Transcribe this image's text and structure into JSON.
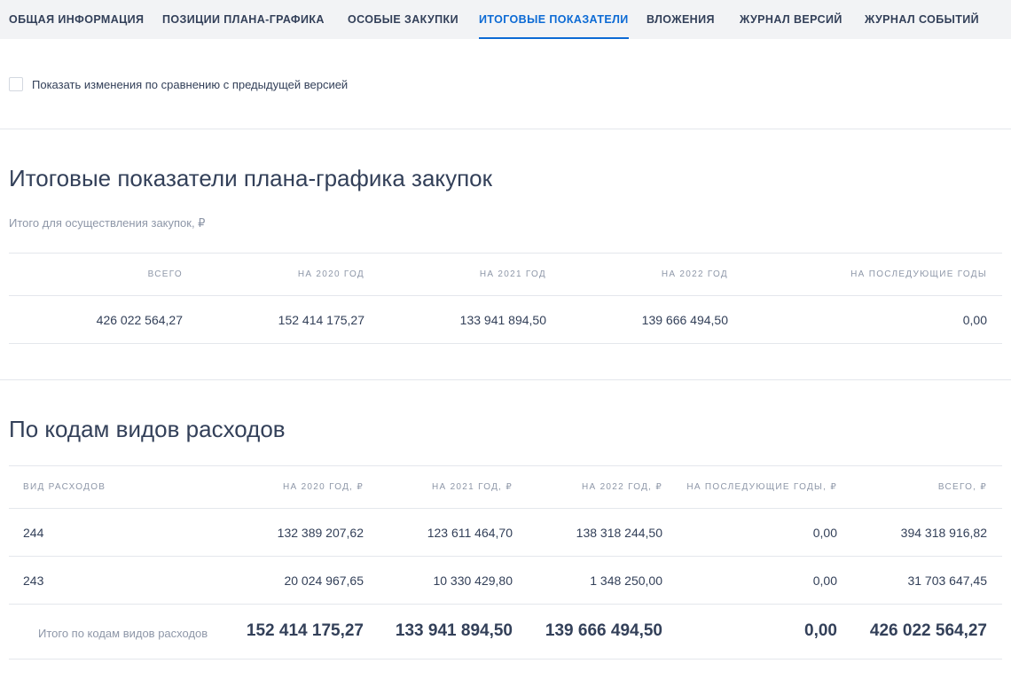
{
  "tabs": [
    {
      "label": "ОБЩАЯ ИНФОРМАЦИЯ",
      "active": false
    },
    {
      "label": "ПОЗИЦИИ ПЛАНА-ГРАФИКА",
      "active": false
    },
    {
      "label": "ОСОБЫЕ ЗАКУПКИ",
      "active": false
    },
    {
      "label": "ИТОГОВЫЕ ПОКАЗАТЕЛИ",
      "active": true
    },
    {
      "label": "ВЛОЖЕНИЯ",
      "active": false
    },
    {
      "label": "ЖУРНАЛ ВЕРСИЙ",
      "active": false
    },
    {
      "label": "ЖУРНАЛ СОБЫТИЙ",
      "active": false
    }
  ],
  "compare": {
    "label": "Показать изменения по сравнению с предыдущей версией",
    "checked": false
  },
  "summary": {
    "title": "Итоговые показатели плана-графика закупок",
    "subtitle": "Итого для осуществления закупок, ₽",
    "columns": [
      "ВСЕГО",
      "НА 2020 ГОД",
      "НА 2021 ГОД",
      "НА 2022 ГОД",
      "НА ПОСЛЕДУЮЩИЕ ГОДЫ"
    ],
    "values": [
      "426 022 564,27",
      "152 414 175,27",
      "133 941 894,50",
      "139 666 494,50",
      "0,00"
    ]
  },
  "by_codes": {
    "title": "По кодам видов расходов",
    "columns": [
      "ВИД РАСХОДОВ",
      "НА 2020 ГОД, ₽",
      "НА 2021 ГОД, ₽",
      "НА 2022 ГОД, ₽",
      "НА ПОСЛЕДУЮЩИЕ ГОДЫ, ₽",
      "ВСЕГО, ₽"
    ],
    "rows": [
      [
        "244",
        "132 389 207,62",
        "123 611 464,70",
        "138 318 244,50",
        "0,00",
        "394 318 916,82"
      ],
      [
        "243",
        "20 024 967,65",
        "10 330 429,80",
        "1 348 250,00",
        "0,00",
        "31 703 647,45"
      ]
    ],
    "total_label": "Итого по кодам видов расходов",
    "totals": [
      "152 414 175,27",
      "133 941 894,50",
      "139 666 494,50",
      "0,00",
      "426 022 564,27"
    ]
  },
  "colors": {
    "accent": "#0c6ad4",
    "text": "#334059",
    "muted": "#8e97a8",
    "divider": "#e4e7ec",
    "tabbar_bg": "#f2f3f5"
  }
}
